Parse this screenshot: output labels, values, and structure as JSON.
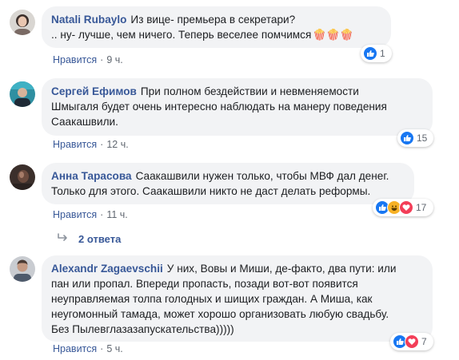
{
  "comments": [
    {
      "author": "Natali Rubaylo",
      "text": "Из вице- премьера в секретари?\n.. ну- лучше, чем ничего. Теперь веселее помчимся",
      "emoji": "🍿🍿🍿",
      "like_label": "Нравится",
      "time": "9 ч.",
      "reaction_count": "1"
    },
    {
      "author": "Сергей Ефимов",
      "text": "При полном бездействии и невменяемости\nШмыгаля будет очень интересно наблюдать на манеру поведения\nСаакашвили.",
      "like_label": "Нравится",
      "time": "12 ч.",
      "reaction_count": "15"
    },
    {
      "author": "Анна Тарасова",
      "text": "Саакашвили нужен только, чтобы МВФ дал денег.\nТолько для этого. Саакашвили никто не даст делать реформы.",
      "like_label": "Нравится",
      "time": "11 ч.",
      "reaction_count": "17"
    },
    {
      "author": "Alexandr Zagaevschii",
      "text": "У них, Вовы и Миши, де-факто, два пути: или\nпан или пропал. Впереди пропасть, позади вот-вот появится\nнеуправляемая толпа голодных и шищих граждан. А Миша, как\nнеугомонный тамада, может хорошо организовать любую свадьбу.\nБез Пылевглазазапускательства)))))",
      "like_label": "Нравится",
      "time": "5 ч.",
      "reaction_count": "7"
    }
  ],
  "replies_label": "2 ответа",
  "dot": "·"
}
